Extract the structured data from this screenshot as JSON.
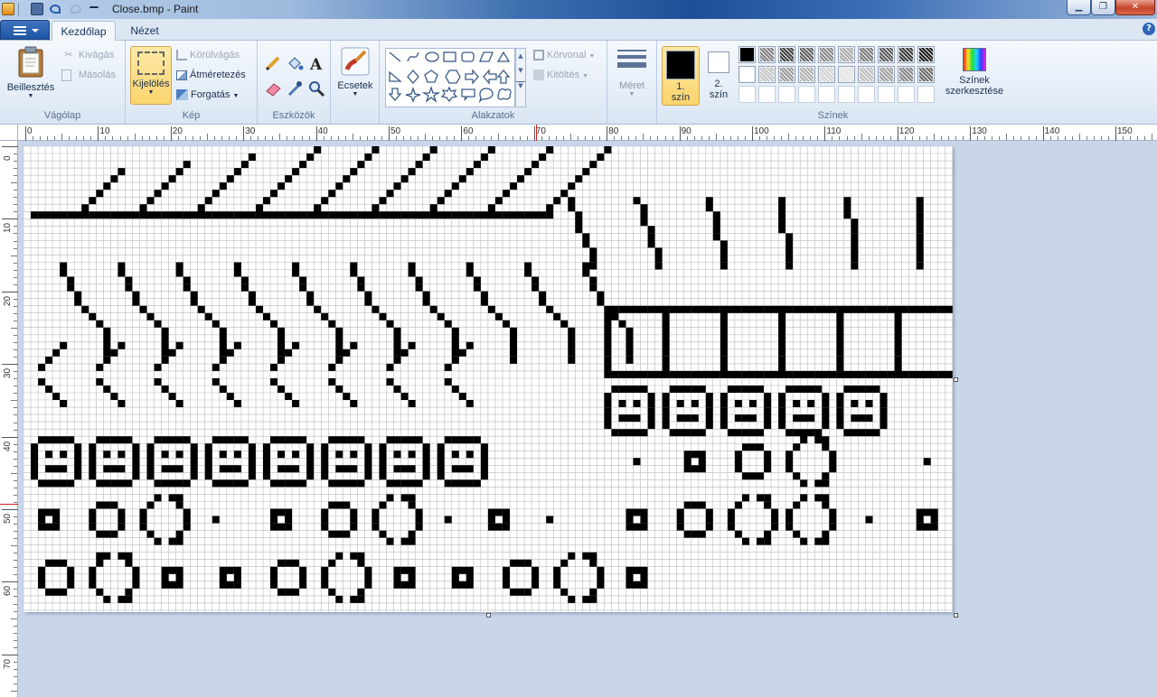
{
  "window": {
    "title": "Close.bmp - Paint"
  },
  "tabs": [
    {
      "label": "Kezdőlap",
      "active": true
    },
    {
      "label": "Nézet",
      "active": false
    }
  ],
  "ribbon": {
    "clipboard": {
      "label": "Vágólap",
      "paste": "Beillesztés",
      "cut": "Kivágás",
      "copy": "Másolás"
    },
    "image": {
      "label": "Kép",
      "select": "Kijelölés",
      "crop": "Körülvágás",
      "resize": "Átméretezés",
      "rotate": "Forgatás"
    },
    "tools": {
      "label": "Eszközök"
    },
    "brushes": {
      "label": "Ecsetek"
    },
    "shapes": {
      "label": "Alakzatok",
      "outline": "Körvonal",
      "fill": "Kitöltés"
    },
    "size": {
      "label": "Méret"
    },
    "colors": {
      "label": "Színek",
      "color1_line1": "1.",
      "color1_line2": "szín",
      "color2_line1": "2.",
      "color2_line2": "szín",
      "color1": "#000000",
      "color2": "#ffffff",
      "edit_line1": "Színek",
      "edit_line2": "szerkesztése"
    }
  },
  "ruler": {
    "h_labels": [
      "0",
      "10",
      "20",
      "30",
      "40",
      "50",
      "60",
      "70",
      "80",
      "90",
      "100",
      "110",
      "120",
      "130",
      "140",
      "150"
    ],
    "v_labels": [
      "0",
      "10",
      "20",
      "30",
      "40",
      "50",
      "60",
      "70"
    ]
  },
  "canvas": {
    "zoom_cells_wide": 128,
    "zoom_cells_high": 64
  }
}
